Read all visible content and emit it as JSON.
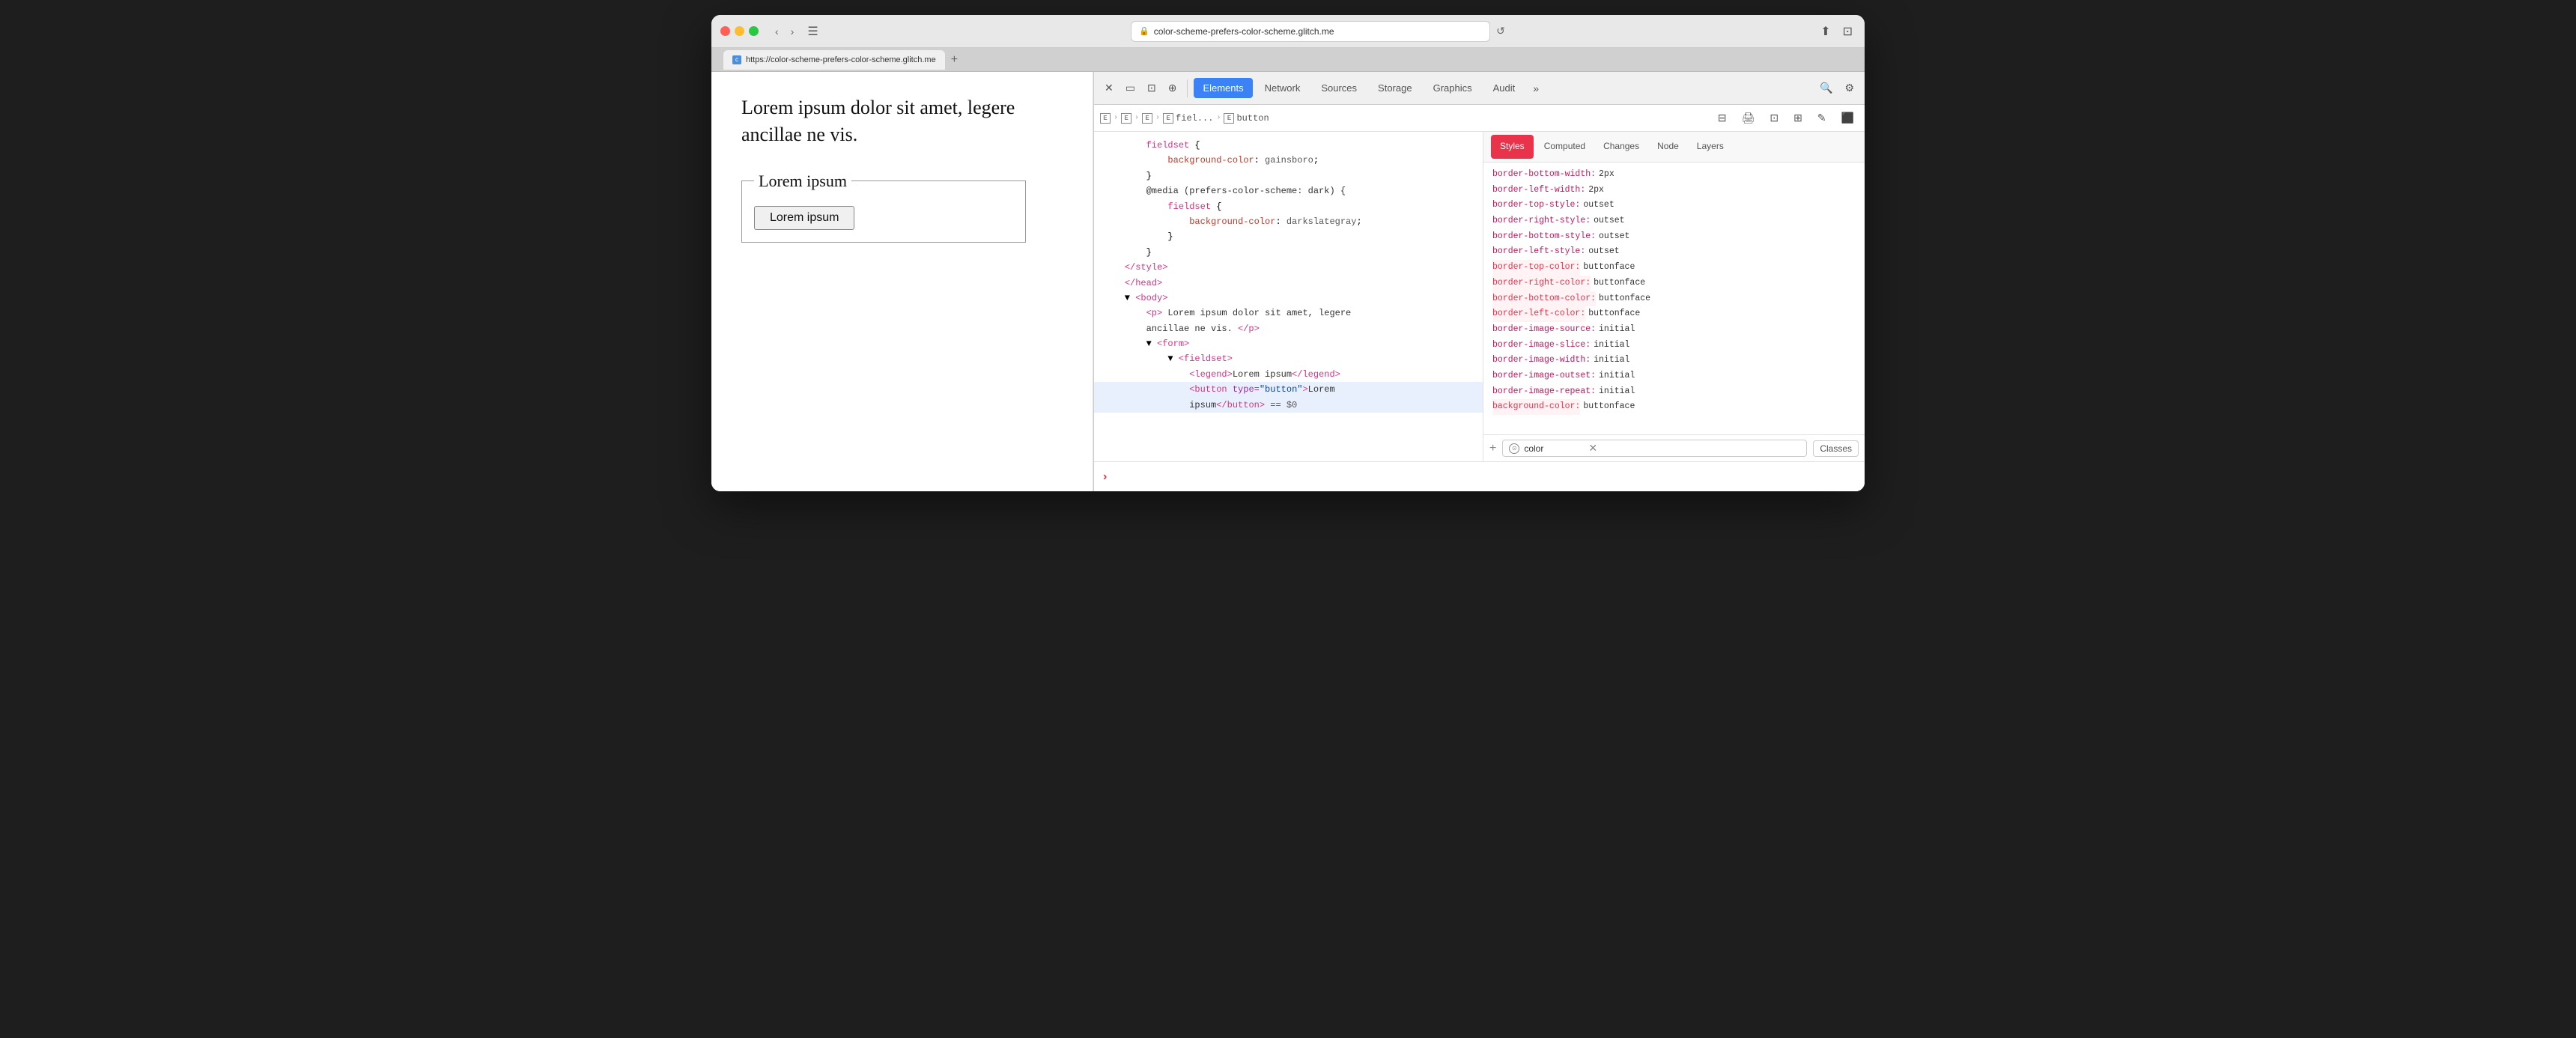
{
  "browser": {
    "title_bar": {
      "url": "color-scheme-prefers-color-scheme.glitch.me",
      "tab_url": "https://color-scheme-prefers-color-scheme.glitch.me",
      "tab_label": "color-scheme-prefers-color-scheme.glitch.me"
    }
  },
  "page": {
    "paragraph": "Lorem ipsum dolor sit amet, legere ancillae ne vis.",
    "legend": "Lorem ipsum",
    "button": "Lorem ipsum"
  },
  "devtools": {
    "tabs": [
      {
        "id": "elements",
        "label": "Elements",
        "active": true
      },
      {
        "id": "network",
        "label": "Network",
        "active": false
      },
      {
        "id": "sources",
        "label": "Sources",
        "active": false
      },
      {
        "id": "storage",
        "label": "Storage",
        "active": false
      },
      {
        "id": "graphics",
        "label": "Graphics",
        "active": false
      },
      {
        "id": "audit",
        "label": "Audit",
        "active": false
      }
    ],
    "breadcrumb": {
      "items": [
        "E",
        "E",
        "E",
        "fiel...",
        "button"
      ]
    },
    "html": {
      "lines": [
        "        fieldset {",
        "            background-color: gainsboro;",
        "        }",
        "        @media (prefers-color-scheme: dark) {",
        "            fieldset {",
        "                background-color: darkslategray;",
        "            }",
        "        }",
        "    </style>",
        "    </head>",
        "    ▼ <body>",
        "        <p> Lorem ipsum dolor sit amet, legere",
        "        ancillae ne vis. </p>",
        "        ▼ <form>",
        "            ▼ <fieldset>",
        "                <legend>Lorem ipsum</legend>",
        "                <button type=\"button\">Lorem",
        "                ipsum</button> == $0"
      ],
      "selected_line": 17
    },
    "styles_tabs": [
      {
        "label": "Styles",
        "active": true
      },
      {
        "label": "Computed",
        "active": false
      },
      {
        "label": "Changes",
        "active": false
      },
      {
        "label": "Node",
        "active": false
      },
      {
        "label": "Layers",
        "active": false
      }
    ],
    "style_properties": [
      {
        "name": "border-bottom-width:",
        "value": "2px",
        "highlighted": false
      },
      {
        "name": "border-left-width:",
        "value": "2px",
        "highlighted": false
      },
      {
        "name": "border-top-style:",
        "value": "outset",
        "highlighted": false
      },
      {
        "name": "border-right-style:",
        "value": "outset",
        "highlighted": false
      },
      {
        "name": "border-bottom-style:",
        "value": "outset",
        "highlighted": false
      },
      {
        "name": "border-left-style:",
        "value": "outset",
        "highlighted": false
      },
      {
        "name": "border-top-color:",
        "value": "buttonface",
        "highlighted": true
      },
      {
        "name": "border-right-color:",
        "value": "buttonface",
        "highlighted": true
      },
      {
        "name": "border-bottom-color:",
        "value": "buttonface",
        "highlighted": true
      },
      {
        "name": "border-left-color:",
        "value": "buttonface",
        "highlighted": true
      },
      {
        "name": "border-image-source:",
        "value": "initial",
        "highlighted": false
      },
      {
        "name": "border-image-slice:",
        "value": "initial",
        "highlighted": false
      },
      {
        "name": "border-image-width:",
        "value": "initial",
        "highlighted": false
      },
      {
        "name": "border-image-outset:",
        "value": "initial",
        "highlighted": false
      },
      {
        "name": "border-image-repeat:",
        "value": "initial",
        "highlighted": false
      },
      {
        "name": "background-color:",
        "value": "buttonface",
        "highlighted": true
      }
    ],
    "filter": {
      "placeholder": "color",
      "classes_label": "Classes"
    },
    "console": {
      "prompt": ">"
    }
  }
}
